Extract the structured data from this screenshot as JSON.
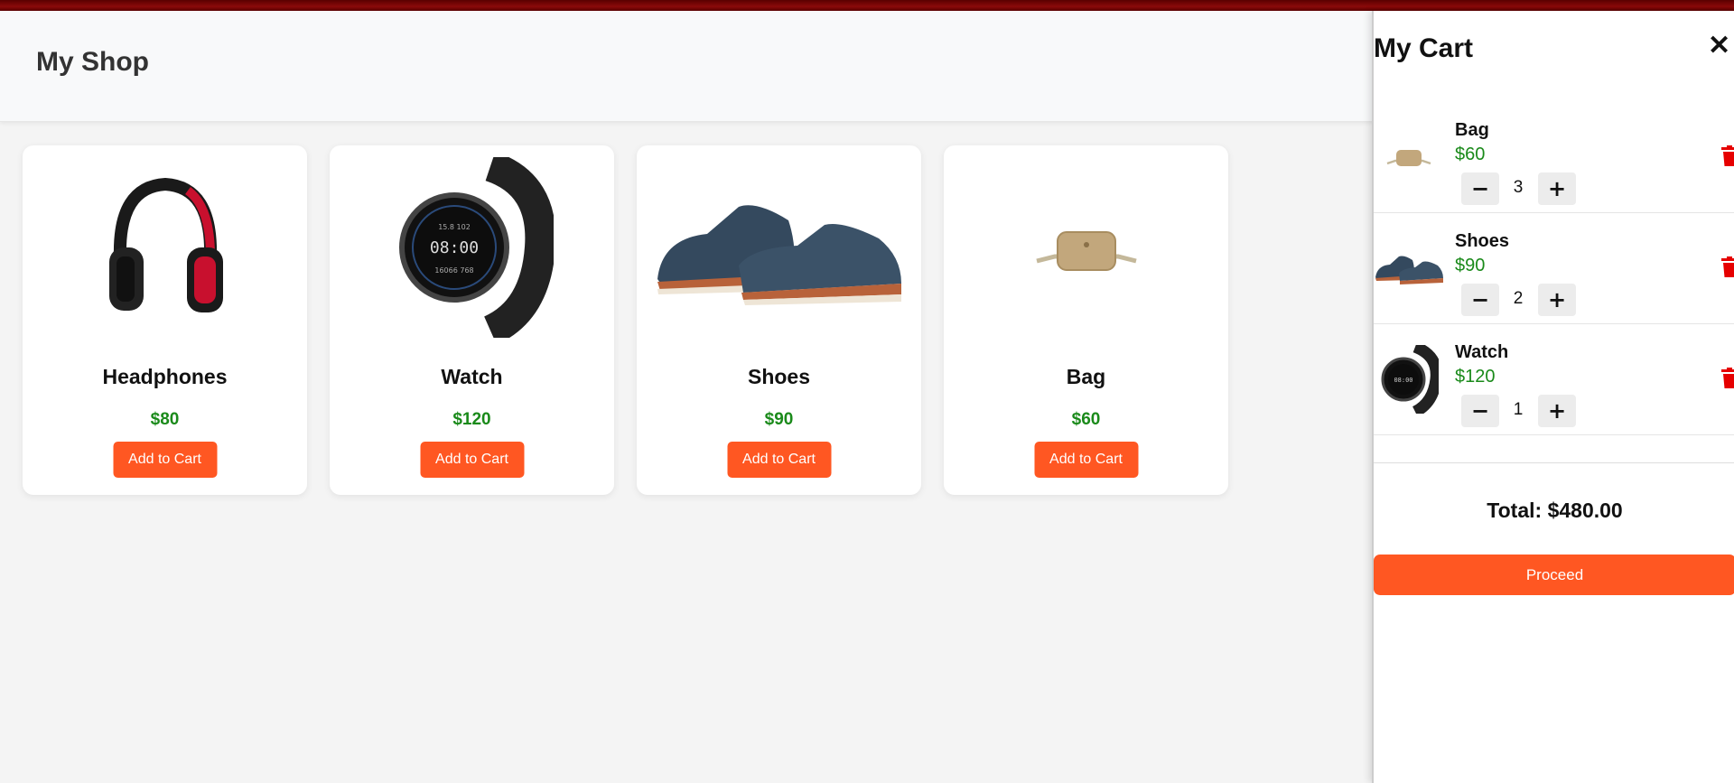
{
  "header": {
    "title": "My Shop"
  },
  "products": [
    {
      "name": "Headphones",
      "price": "$80",
      "button_label": "Add to Cart",
      "icon": "headphones-image"
    },
    {
      "name": "Watch",
      "price": "$120",
      "button_label": "Add to Cart",
      "icon": "watch-image"
    },
    {
      "name": "Shoes",
      "price": "$90",
      "button_label": "Add to Cart",
      "icon": "shoes-image"
    },
    {
      "name": "Bag",
      "price": "$60",
      "button_label": "Add to Cart",
      "icon": "bag-image"
    }
  ],
  "cart": {
    "title": "My Cart",
    "close_label": "✕",
    "items": [
      {
        "name": "Bag",
        "price": "$60",
        "quantity": "3",
        "minus": "−",
        "plus": "+"
      },
      {
        "name": "Shoes",
        "price": "$90",
        "quantity": "2",
        "minus": "−",
        "plus": "+"
      },
      {
        "name": "Watch",
        "price": "$120",
        "quantity": "1",
        "minus": "−",
        "plus": "+"
      }
    ],
    "total": "Total: $480.00",
    "proceed_label": "Proceed"
  },
  "colors": {
    "accent": "#ff5722",
    "price": "#1a8a1a",
    "delete": "#e60000",
    "topbar": "#8b0a0a"
  }
}
